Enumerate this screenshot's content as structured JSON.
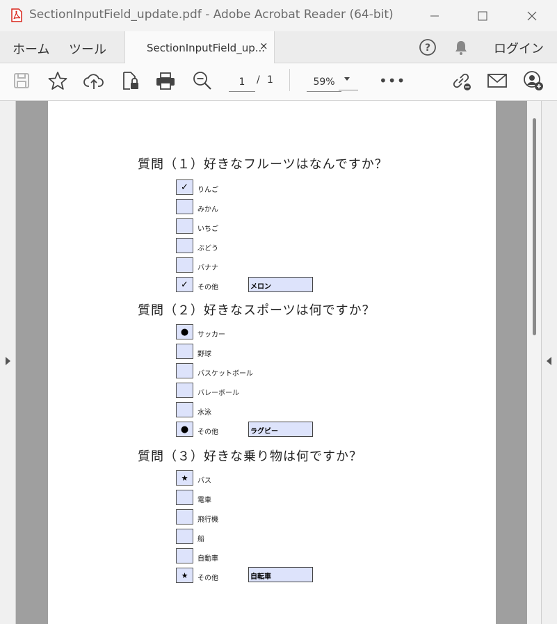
{
  "window": {
    "title": "SectionInputField_update.pdf - Adobe Acrobat Reader (64-bit)"
  },
  "menu": {
    "home": "ホーム",
    "tools": "ツール",
    "tab_label": "SectionInputField_up...",
    "tab_close": "×",
    "login": "ログイン"
  },
  "toolbar": {
    "page_current": "1",
    "page_separator": "/",
    "page_total": "1",
    "zoom": "59%",
    "more": "•••"
  },
  "form": {
    "questions": [
      {
        "title": "質問（１）好きなフルーツはなんですか？",
        "mark": "✓",
        "options": [
          {
            "label": "りんご",
            "checked": true
          },
          {
            "label": "みかん",
            "checked": false
          },
          {
            "label": "いちご",
            "checked": false
          },
          {
            "label": "ぶどう",
            "checked": false
          },
          {
            "label": "バナナ",
            "checked": false
          },
          {
            "label": "その他",
            "checked": true
          }
        ],
        "other_value": "メロン"
      },
      {
        "title": "質問（２）好きなスポーツは何ですか？",
        "mark": "●",
        "options": [
          {
            "label": "サッカー",
            "checked": true
          },
          {
            "label": "野球",
            "checked": false
          },
          {
            "label": "バスケットボール",
            "checked": false
          },
          {
            "label": "バレーボール",
            "checked": false
          },
          {
            "label": "水泳",
            "checked": false
          },
          {
            "label": "その他",
            "checked": true
          }
        ],
        "other_value": "ラグビー"
      },
      {
        "title": "質問（３）好きな乗り物は何ですか？",
        "mark": "★",
        "options": [
          {
            "label": "バス",
            "checked": true
          },
          {
            "label": "電車",
            "checked": false
          },
          {
            "label": "飛行機",
            "checked": false
          },
          {
            "label": "船",
            "checked": false
          },
          {
            "label": "自動車",
            "checked": false
          },
          {
            "label": "その他",
            "checked": true
          }
        ],
        "other_value": "自転車"
      }
    ]
  }
}
